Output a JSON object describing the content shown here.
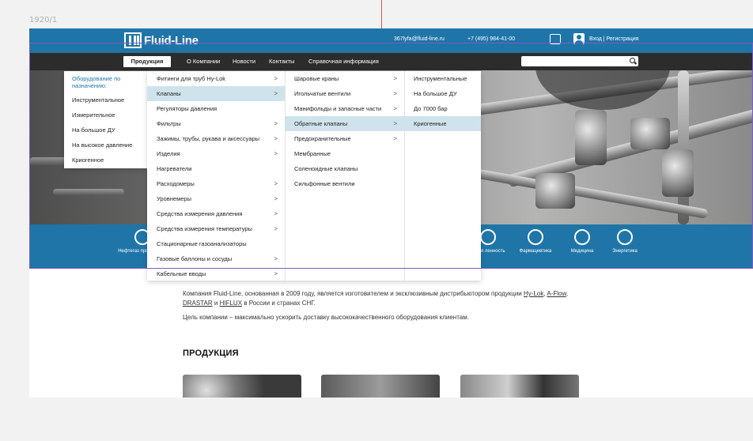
{
  "canvas_label": "1920/1",
  "header": {
    "logo_text": "Fluid-Line",
    "email": "367lyfa@fluid-line.ru",
    "phone": "+7 (495) 984-41-00",
    "login_label": "Вход | Регистрация"
  },
  "nav": {
    "items": [
      "Продукция",
      "О Компании",
      "Новости",
      "Контакты",
      "Справочная информация"
    ],
    "search_placeholder": ""
  },
  "menu": {
    "col1": {
      "heading": "Оборудование по назначению:",
      "items": [
        "Инструментальное",
        "Измерительное",
        "На большое ДУ",
        "На высокое давление",
        "Криогенное"
      ]
    },
    "col2": {
      "items": [
        "Фитинги для труб Hy-Lok",
        "Клапаны",
        "Регуляторы давления",
        "Фильтры",
        "Зажимы, трубы, рукава и аксессуары",
        "Изделия",
        "Нагреватели",
        "Расходомеры",
        "Уровнемеры",
        "Средства измерения давления",
        "Средства измерения температуры",
        "Стационарные газоанализаторы",
        "Газовые баллоны и сосуды",
        "Кабельные вводы"
      ],
      "active_index": 1
    },
    "col3": {
      "items": [
        "Шаровые краны",
        "Игольчатые вентили",
        "Манифольды и запасные части",
        "Обратные клапаны",
        "Предохранительные",
        "Мембранные",
        "Соленоидные клапаны",
        "Сильфонные вентили"
      ],
      "active_index": 3
    },
    "col4": {
      "items": [
        "Инструментальные",
        "На большое ДУ",
        "До 7000 бар",
        "Криогенные"
      ],
      "active_index": 3
    }
  },
  "industries": {
    "left_label": "Нефтегаз промышлен",
    "right_partial": "товая ленность",
    "items": [
      "Фармацевтика",
      "Медицина",
      "Энергетика"
    ]
  },
  "content": {
    "intro_pre": "Компания Fluid-Line, основанная в 2009 году, является изготовителем и эксклюзивным дистрибьютором продукции",
    "link_hylok": "Hy-Lok",
    "link_aflow": "A-Flow",
    "link_drastar": "DRASTAR",
    "and": "и",
    "link_hiflux": "HIFLUX",
    "intro_post": "в России и странах СНГ.",
    "goal": "Цель компании – максимально ускорить доставку высококачественного оборудования клиентам.",
    "products_heading": "ПРОДУКЦИЯ"
  },
  "colors": {
    "brand_blue": "#1f75a8",
    "nav_dark": "#2c2c2c",
    "menu_active": "#cfe3ec",
    "frame_purple": "#7a5cc6",
    "guide_red": "#e0564a"
  }
}
